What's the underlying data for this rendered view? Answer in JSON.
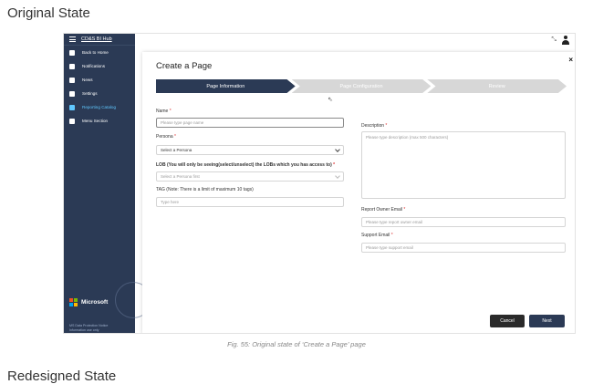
{
  "section_title": "Original State",
  "section_title_next": "Redesigned State",
  "caption": "Fig. 55: Original state of ‘Create a Page’ page",
  "sidebar": {
    "header": "CD&S BI Hub",
    "items": [
      {
        "label": "Back to Home",
        "icon": "back-arrow-icon"
      },
      {
        "label": "Notifications",
        "icon": "bell-icon"
      },
      {
        "label": "News",
        "icon": "news-icon"
      },
      {
        "label": "Settings",
        "icon": "gear-icon"
      },
      {
        "label": "Reporting Catalog",
        "icon": "catalog-icon",
        "active": true
      },
      {
        "label": "Menu Section",
        "icon": "menu-icon"
      }
    ],
    "brand": "Microsoft",
    "footer_line1": "MS Data Protection Notice",
    "footer_line2": "Information use only"
  },
  "modal": {
    "title": "Create a Page",
    "close": "×",
    "steps": [
      "Page Information",
      "Page Configuration",
      "Review"
    ],
    "name_label": "Name",
    "name_placeholder": "Please type page name",
    "persona_label": "Persona",
    "persona_value": "Select a Persona",
    "lob_label": "LOB (You will only be seeing(select/unselect) the LOBs which you has access to)",
    "lob_value": "Select a Persona first",
    "tag_label": "TAG (Note: There is a limit of maximum 10 tags)",
    "tag_placeholder": "Type here",
    "description_label": "Description",
    "description_placeholder": "Please type description (max 500 characters)",
    "report_owner_label": "Report Owner Email",
    "report_owner_placeholder": "Please type report owner email",
    "support_email_label": "Support Email",
    "support_email_placeholder": "Please type support email",
    "required_mark": "*",
    "cancel": "Cancel",
    "next": "Next"
  },
  "colors": {
    "sidebar_bg": "#2b3a55",
    "active_item": "#5fc7ff",
    "step_active": "#2b3a55",
    "step_inactive": "#d7d7d7"
  }
}
